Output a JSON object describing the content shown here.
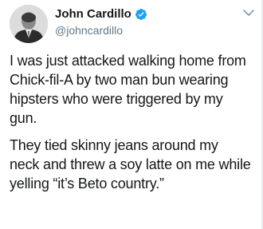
{
  "tweet": {
    "author": {
      "display_name": "John Cardillo",
      "handle": "@johncardillo",
      "verified": true
    },
    "paragraphs": [
      "I was just attacked walking home from\nChick-fil-A by two man bun wearing\nhipsters who were triggered by my\ngun.",
      "They tied skinny jeans around my\nneck and threw a soy latte on me while\nyelling “it’s Beto country.”"
    ]
  },
  "icons": {
    "verified": "verified-badge-icon",
    "menu": "chevron-down-icon"
  },
  "colors": {
    "verified_blue": "#1da1f2",
    "handle_gray": "#657786",
    "text": "#14171a"
  }
}
